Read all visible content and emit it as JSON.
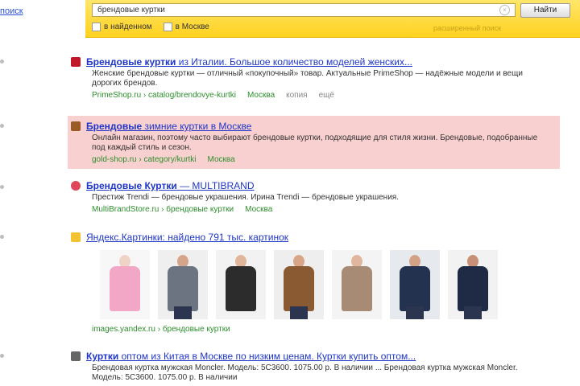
{
  "left_link": "поиск",
  "search": {
    "query": "брендовые куртки",
    "button": "Найти",
    "filters": [
      "в найденном",
      "в Москве"
    ],
    "advanced": "расширенный поиск"
  },
  "results": [
    {
      "title_bold": "Брендовые куртки",
      "title_rest": " из Италии. Большое количество моделей женских...",
      "snippet": "Женские брендовые куртки — отличный «покупочный» товар. Актуальные PrimeShop — надёжные модели и вещи дорогих брендов.",
      "url": "PrimeShop.ru › catalog/brendovye-kurtki",
      "region": "Москва",
      "extra": [
        "копия",
        "ещё"
      ],
      "favicon_color": "#c0162a"
    },
    {
      "title_bold": "Брендовые",
      "title_rest": " зимние куртки в Москве",
      "snippet": "Онлайн магазин, поэтому часто выбирают брендовые куртки, подходящие для стиля жизни. Брендовые, подобранные под каждый стиль и сезон.",
      "url": "gold-shop.ru › category/kurtki",
      "region": "Москва",
      "extra": [],
      "favicon_color": "#9b5a25"
    },
    {
      "title_bold": "Брендовые Куртки",
      "title_rest": " — MULTIBRAND",
      "snippet": "Престиж Trendi — брендовые украшения. Ирина Trendi — брендовые украшения.",
      "url": "MultiBrandStore.ru › брендовые куртки",
      "region": "Москва",
      "extra": [],
      "favicon_color": "#e0465a"
    },
    {
      "title_bold": "",
      "title_rest": "Яндекс.Картинки: найдено 791 тыс. картинок",
      "snippet": "",
      "url": "images.yandex.ru › брендовые куртки",
      "region": "",
      "extra": [],
      "favicon_color": "#f2c233"
    },
    {
      "title_bold": "Куртки",
      "title_rest": " оптом из Китая в Москве по низким ценам. Куртки купить оптом...",
      "snippet": "Брендовая куртка мужская Moncler. Модель: 5C3600. 1075.00 р. В наличии ... Брендовая куртка мужская Moncler. Модель: 5C3600. 1075.00 р. В наличии",
      "url": "",
      "region": "",
      "extra": [],
      "favicon_color": "#666666"
    }
  ],
  "image_thumbs": [
    {
      "body": "#f2a7c6",
      "skin": "#f0d3c7"
    },
    {
      "body": "#6b7480",
      "skin": "#d6a48a"
    },
    {
      "body": "#2c2c2c",
      "skin": "#e0b59a"
    },
    {
      "body": "#8a5a33",
      "skin": "#d9a587"
    },
    {
      "body": "#a88b74",
      "skin": "#e0b79e"
    },
    {
      "body": "#22324f",
      "skin": "#d3a286"
    },
    {
      "body": "#1f2a44",
      "skin": "#c79077"
    }
  ]
}
